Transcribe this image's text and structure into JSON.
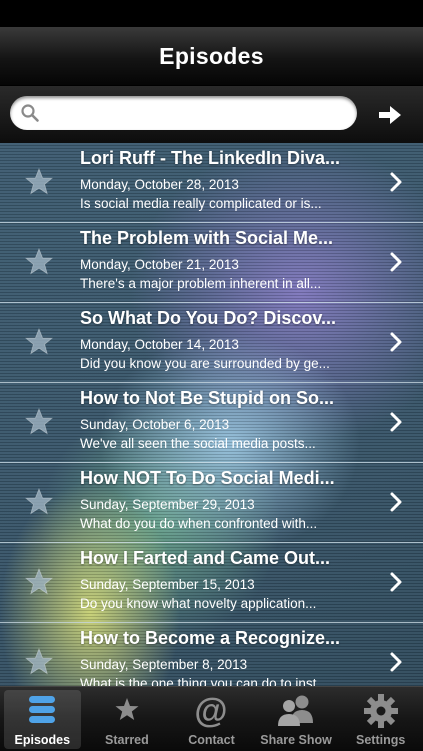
{
  "nav": {
    "title": "Episodes"
  },
  "search": {
    "placeholder": ""
  },
  "episodes": [
    {
      "title": "Lori Ruff - The LinkedIn Diva...",
      "date": "Monday, October 28, 2013",
      "desc": "Is social media really complicated or is..."
    },
    {
      "title": "The Problem with Social Me...",
      "date": "Monday, October 21, 2013",
      "desc": "There's a major problem inherent in all..."
    },
    {
      "title": "So What Do You Do? Discov...",
      "date": "Monday, October 14, 2013",
      "desc": "Did you know you are surrounded by ge..."
    },
    {
      "title": "How to Not Be Stupid on So...",
      "date": "Sunday, October 6, 2013",
      "desc": "We've all seen the social media posts..."
    },
    {
      "title": "How NOT To Do Social Medi...",
      "date": "Sunday, September 29, 2013",
      "desc": "What do you do when confronted with..."
    },
    {
      "title": "How I Farted and Came Out...",
      "date": "Sunday, September 15, 2013",
      "desc": "Do you know what novelty application..."
    },
    {
      "title": "How to Become a Recognize...",
      "date": "Sunday, September 8, 2013",
      "desc": "What is the one thing you can do to inst..."
    }
  ],
  "tabs": [
    {
      "label": "Episodes",
      "icon": "episodes-icon",
      "active": true
    },
    {
      "label": "Starred",
      "icon": "star-icon",
      "active": false
    },
    {
      "label": "Contact",
      "icon": "at-sign-icon",
      "active": false
    },
    {
      "label": "Share Show",
      "icon": "people-icon",
      "active": false
    },
    {
      "label": "Settings",
      "icon": "gear-icon",
      "active": false
    }
  ],
  "colors": {
    "row_divider": "#d2e1eb",
    "active_tab_icon": "#4fa3e8"
  }
}
